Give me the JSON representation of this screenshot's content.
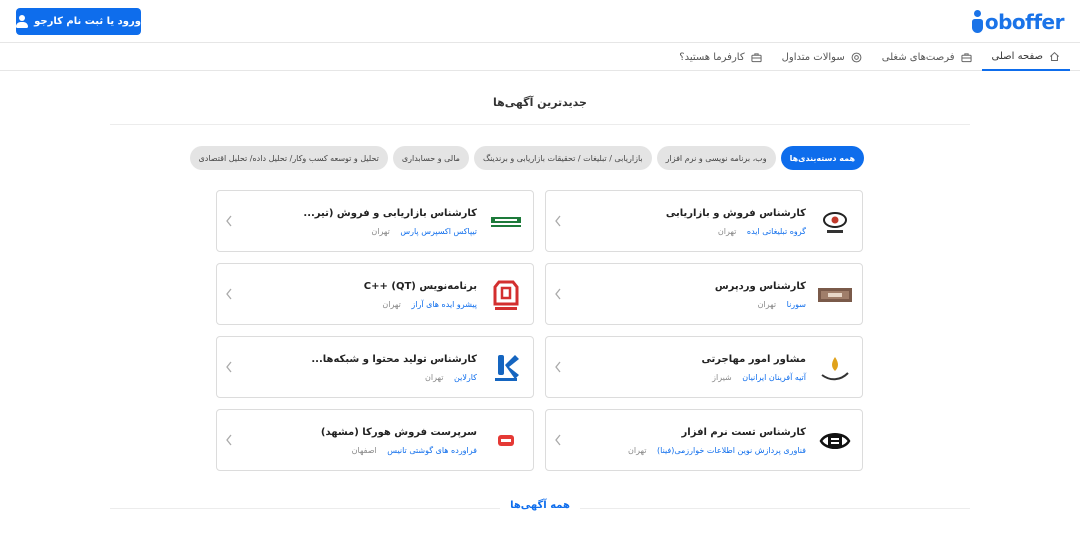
{
  "header": {
    "logo_text": "oboffer",
    "login_button": "ورود یا ثبت نام کارجو"
  },
  "nav": {
    "items": [
      {
        "label": "صفحه اصلی",
        "icon": "home-icon",
        "active": true
      },
      {
        "label": "فرصت‌های شغلی",
        "icon": "briefcase-icon",
        "active": false
      },
      {
        "label": "سوالات متداول",
        "icon": "support-icon",
        "active": false
      },
      {
        "label": "کارفرما هستید؟",
        "icon": "briefcase-icon",
        "active": false
      }
    ]
  },
  "main": {
    "title": "جدیدترین آگهی‌ها",
    "chips": [
      {
        "label": "همه دسته‌بندی‌ها",
        "active": true
      },
      {
        "label": "وب، برنامه نویسی و نرم افزار",
        "active": false
      },
      {
        "label": "بازاریابی / تبلیغات / تحقیقات بازاریابی و برندینگ",
        "active": false
      },
      {
        "label": "مالی و حسابداری",
        "active": false
      },
      {
        "label": "تحلیل و توسعه کسب وکار/ تحلیل داده/ تحلیل اقتصادی",
        "active": false
      }
    ],
    "jobs": [
      {
        "title": "کارشناس فروش و بازاریابی",
        "company": "گروه تبلیغاتی ایده",
        "city": "تهران",
        "logo": "eye-logo"
      },
      {
        "title": "کارشناس بازاریابی و فروش (تیر...",
        "company": "تیپاکس اکسپرس پارس",
        "city": "تهران",
        "logo": "tipax-logo"
      },
      {
        "title": "کارشناس وردپرس",
        "company": "سورنا",
        "city": "تهران",
        "logo": "sorena-logo"
      },
      {
        "title": "برنامه‌نویس (QT) ++C",
        "company": "پیشرو ایده های آراز",
        "city": "تهران",
        "logo": "piaraz-logo"
      },
      {
        "title": "مشاور امور مهاجرتی",
        "company": "آتیه آفرینان ایرانیان",
        "city": "شیراز",
        "logo": "atieh-logo"
      },
      {
        "title": "کارشناس تولید محتوا و شبکه‌ها...",
        "company": "کارلاین",
        "city": "تهران",
        "logo": "carline-logo"
      },
      {
        "title": "کارشناس تست نرم افزار",
        "company": "فناوری پردازش نوین اطلاعات خوارزمی(فینا)",
        "city": "تهران",
        "logo": "fina-logo"
      },
      {
        "title": "سرپرست فروش هورکا (مشهد)",
        "company": "فراورده های گوشتی تانیس",
        "city": "اصفهان",
        "logo": "tanis-logo"
      }
    ],
    "all_link": "همه آگهی‌ها"
  },
  "colors": {
    "accent": "#0e6dec",
    "chip_bg": "#e4e4e4",
    "muted": "#888888"
  }
}
